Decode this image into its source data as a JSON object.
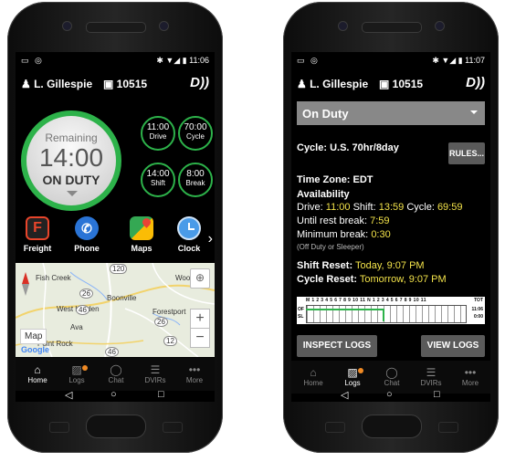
{
  "status_bar": {
    "phone1_time": "11:06",
    "phone2_time": "11:07"
  },
  "header": {
    "driver_name": "L. Gillespie",
    "truck_number": "10515",
    "logo": "D))"
  },
  "phone1": {
    "remaining": {
      "label": "Remaining",
      "time": "14:00",
      "status": "ON DUTY"
    },
    "timers": [
      {
        "value": "11:00",
        "label": "Drive"
      },
      {
        "value": "70:00",
        "label": "Cycle"
      },
      {
        "value": "14:00",
        "label": "Shift"
      },
      {
        "value": "8:00",
        "label": "Break"
      }
    ],
    "apps": [
      {
        "label": "Freight",
        "icon": "freight-app-icon",
        "color": "#e8452b"
      },
      {
        "label": "Phone",
        "icon": "phone-app-icon",
        "color": "#2a74d6"
      },
      {
        "label": "Maps",
        "icon": "maps-app-icon",
        "color": "#34a853"
      },
      {
        "label": "Clock",
        "icon": "clock-app-icon",
        "color": "#4a9be8"
      }
    ],
    "map": {
      "places": [
        "Fish Creek",
        "Woodgate",
        "West Leyden",
        "Boonville",
        "Forestport",
        "Ava",
        "Point Rock"
      ],
      "roads": [
        "120",
        "26",
        "46",
        "12",
        "26",
        "46"
      ],
      "map_type_label": "Map",
      "brand": "Google"
    }
  },
  "phone2": {
    "duty_status": "On Duty",
    "cycle": "Cycle: U.S. 70hr/8day",
    "rules_button": "RULES...",
    "time_zone": "Time Zone: EDT",
    "availability_title": "Availability",
    "drive_label": "Drive:",
    "drive_value": "11:00",
    "shift_label": "Shift:",
    "shift_value": "13:59",
    "cycle_label": "Cycle:",
    "cycle_value": "69:59",
    "rest_label": "Until rest break:",
    "rest_value": "7:59",
    "min_break_label": "Minimum break:",
    "min_break_value": "0:30",
    "min_break_note": "(Off Duty or Sleeper)",
    "shift_reset_label": "Shift Reset:",
    "shift_reset_value": "Today, 9:07 PM",
    "cycle_reset_label": "Cycle Reset:",
    "cycle_reset_value": "Tomorrow, 9:07 PM",
    "log_grid": {
      "hours": "M 1 2 3 4 5 6 7 8 9 10 11 N 1 2 3 4 5 6 7 8 9 10 11",
      "total_label": "TOT",
      "rows": [
        "OF",
        "SL"
      ],
      "totals": [
        "11:06",
        "0:00"
      ]
    },
    "inspect_button": "INSPECT LOGS",
    "view_button": "VIEW LOGS"
  },
  "bottom_nav": [
    {
      "label": "Home",
      "icon": "home-icon"
    },
    {
      "label": "Logs",
      "icon": "logs-icon"
    },
    {
      "label": "Chat",
      "icon": "chat-icon"
    },
    {
      "label": "DVIRs",
      "icon": "dvirs-icon"
    },
    {
      "label": "More",
      "icon": "more-icon"
    }
  ],
  "colors": {
    "accent_green": "#2db24a",
    "highlight_yellow": "#f3e34a",
    "badge_orange": "#f08a24"
  }
}
